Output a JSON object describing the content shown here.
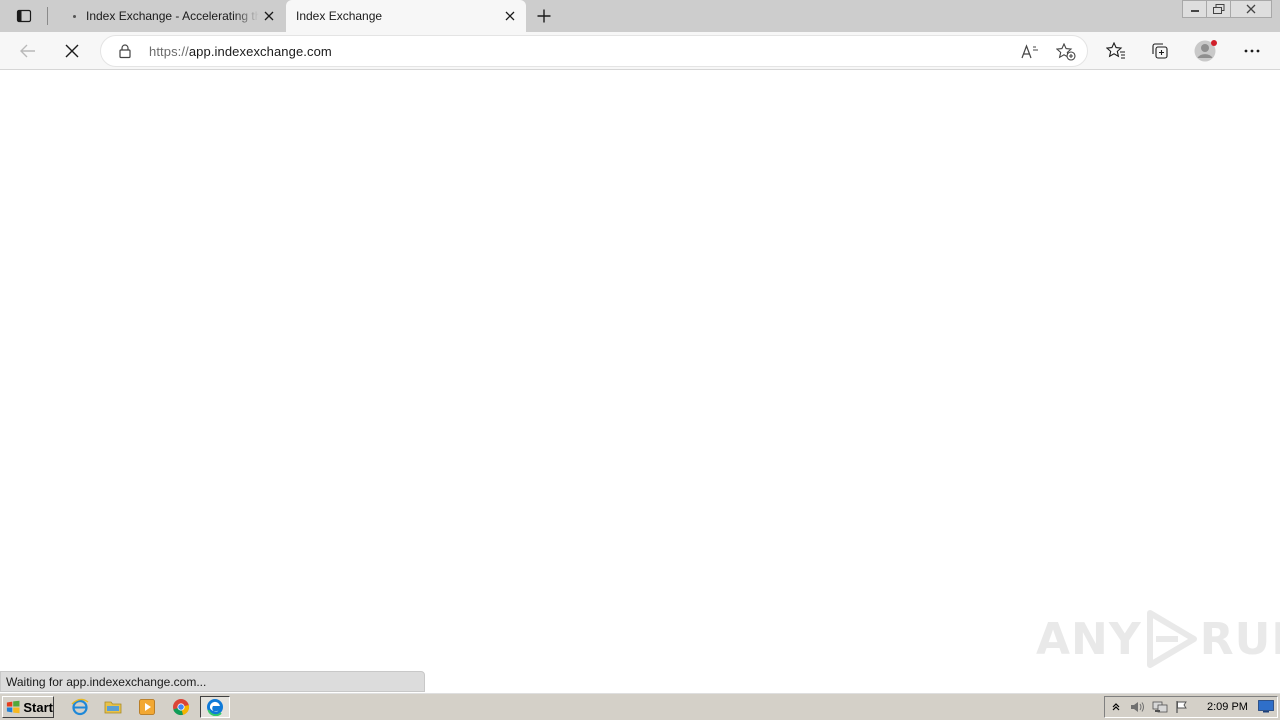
{
  "tabs": [
    {
      "title": "Index Exchange - Accelerating the",
      "active": false
    },
    {
      "title": "Index Exchange",
      "active": true
    }
  ],
  "address": {
    "scheme": "https://",
    "host": "app.indexexchange.com"
  },
  "status": {
    "text": "Waiting for app.indexexchange.com..."
  },
  "watermark": {
    "left": "ANY",
    "right": "RUN"
  },
  "taskbar": {
    "start_label": "Start",
    "clock": "2:09 PM"
  },
  "icons": {
    "tab_actions": "tab-actions-icon",
    "close_tab": "close-icon",
    "new_tab": "plus-icon",
    "back": "back-arrow-icon",
    "stop": "stop-icon",
    "lock": "lock-icon",
    "read_aloud": "read-aloud-icon",
    "add_favorite": "add-favorite-icon",
    "favorites": "favorites-icon",
    "collections": "collections-icon",
    "profile": "profile-icon",
    "more": "more-icon"
  },
  "colors": {
    "tabstrip": "#cdcdcd",
    "toolbar": "#f7f7f7",
    "taskbar": "#d4d0c8",
    "edge_blue": "#0f7ad8",
    "profile_dot": "#d1202b"
  }
}
